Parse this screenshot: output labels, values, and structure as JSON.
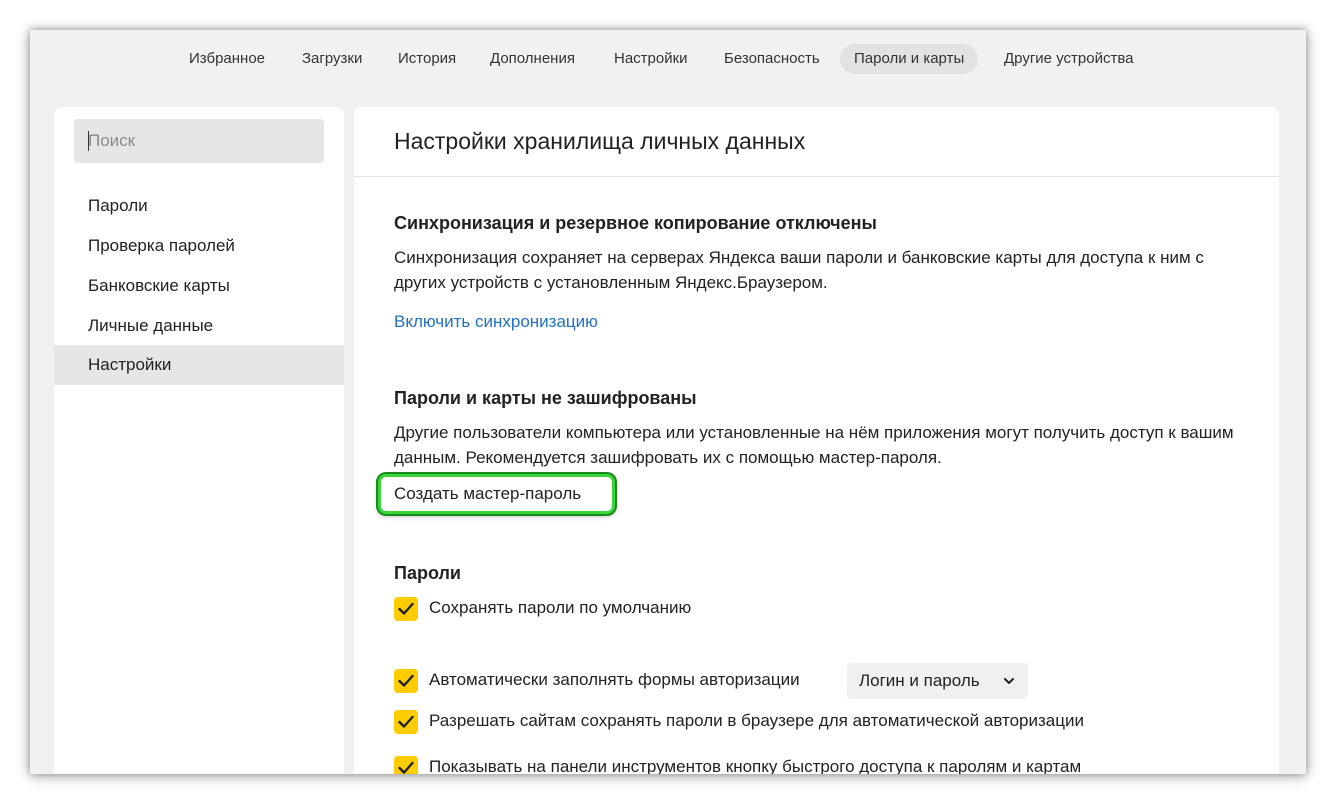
{
  "topnav": {
    "tabs": [
      {
        "label": "Избранное"
      },
      {
        "label": "Загрузки"
      },
      {
        "label": "История"
      },
      {
        "label": "Дополнения"
      },
      {
        "label": "Настройки"
      },
      {
        "label": "Безопасность"
      },
      {
        "label": "Пароли и карты",
        "active": true
      },
      {
        "label": "Другие устройства"
      }
    ]
  },
  "sidebar": {
    "search_placeholder": "Поиск",
    "items": [
      {
        "label": "Пароли"
      },
      {
        "label": "Проверка паролей"
      },
      {
        "label": "Банковские карты"
      },
      {
        "label": "Личные данные"
      },
      {
        "label": "Настройки",
        "active": true
      }
    ]
  },
  "main": {
    "title": "Настройки хранилища личных данных",
    "sync": {
      "title": "Синхронизация и резервное копирование отключены",
      "text": "Синхронизация сохраняет на серверах Яндекса ваши пароли и банковские карты для доступа к ним с других устройств с установленным Яндекс.Браузером.",
      "link": "Включить синхронизацию"
    },
    "encryption": {
      "title": "Пароли и карты не зашифрованы",
      "text": "Другие пользователи компьютера или установленные на нём приложения могут получить доступ к вашим данным. Рекомендуется зашифровать их с помощью мастер-пароля.",
      "button": "Создать мастер-пароль"
    },
    "passwords": {
      "title": "Пароли",
      "options": [
        {
          "label": "Сохранять пароли по умолчанию",
          "checked": true
        },
        {
          "label": "Автоматически заполнять формы авторизации",
          "checked": true
        },
        {
          "label": "Разрешать сайтам сохранять пароли в браузере для автоматической авторизации",
          "checked": true
        },
        {
          "label": "Показывать на панели инструментов кнопку быстрого доступа к паролям и картам",
          "checked": true
        }
      ],
      "autofill_select": "Логин и пароль"
    }
  },
  "colors": {
    "window_bg": "#f2f1ef",
    "checkbox": "#ffcc00",
    "link": "#2170c4",
    "highlight": "#3bd43b"
  }
}
